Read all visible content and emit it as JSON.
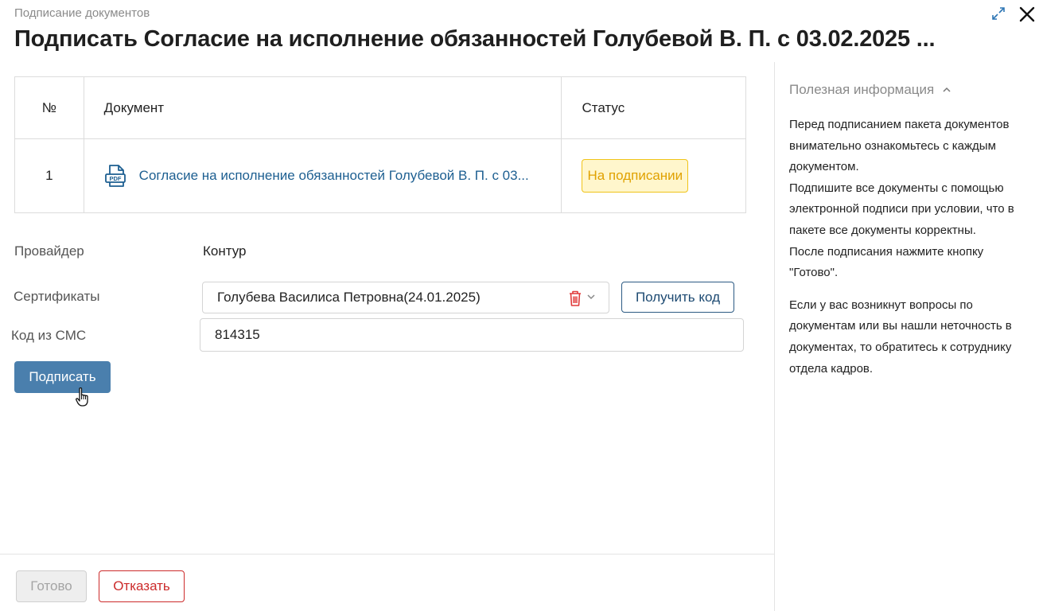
{
  "header": {
    "subtitle": "Подписание документов",
    "title": "Подписать Согласие на исполнение обязанностей Голубевой В. П. с 03.02.2025 ..."
  },
  "table": {
    "headers": {
      "num": "№",
      "document": "Документ",
      "status": "Статус"
    },
    "rows": [
      {
        "num": "1",
        "document": "Согласие на исполнение обязанностей Голубевой В. П. с 03...",
        "status": "На подписании",
        "icon": "pdf-file-icon"
      }
    ]
  },
  "form": {
    "provider_label": "Провайдер",
    "provider_value": "Контур",
    "certificates_label": "Сертификаты",
    "certificate_value": "Голубева Василиса Петровна(24.01.2025)",
    "get_code_label": "Получить код",
    "sms_label": "Код из СМС",
    "sms_value": "814315",
    "sign_label": "Подписать"
  },
  "footer": {
    "done_label": "Готово",
    "refuse_label": "Отказать"
  },
  "info": {
    "title": "Полезная информация",
    "paragraph1": [
      "Перед подписанием пакета документов",
      "внимательно ознакомьтесь с каждым",
      "документом.",
      "Подпишите все документы с помощью",
      "электронной подписи при условии, что в",
      "пакете все документы корректны.",
      "После подписания нажмите кнопку",
      "\"Готово\"."
    ],
    "paragraph2": [
      "Если у вас возникнут вопросы по",
      "документам или вы нашли неточность в",
      "документах, то обратитесь к сотруднику",
      "отдела кадров."
    ]
  },
  "colors": {
    "link": "#1d5f91",
    "primary_button": "#4a7fad",
    "status_bg": "#fff6cc",
    "status_border": "#f0c419",
    "status_text": "#e0a100",
    "danger": "#cc2b2b"
  }
}
